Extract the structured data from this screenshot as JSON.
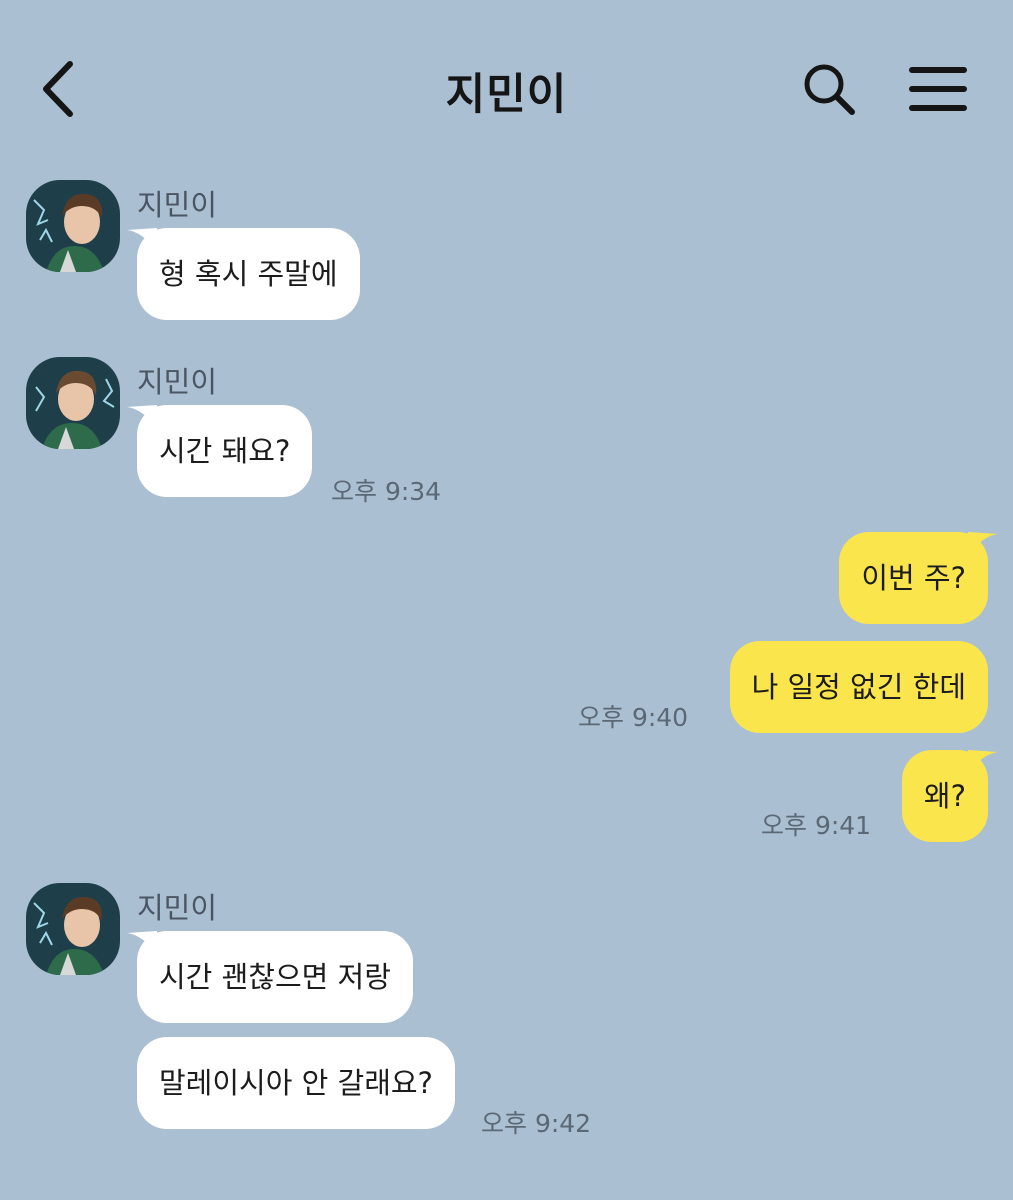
{
  "header": {
    "title": "지민이",
    "back_icon": "chevron-left-icon",
    "search_icon": "search-icon",
    "menu_icon": "hamburger-menu-icon"
  },
  "colors": {
    "background": "#abbfd2",
    "incoming_bubble": "#ffffff",
    "outgoing_bubble": "#fae54d",
    "timestamp": "#5b6875"
  },
  "messages": {
    "group1": {
      "sender": "지민이",
      "texts": [
        "형 혹시 주말에"
      ]
    },
    "group2": {
      "sender": "지민이",
      "texts": [
        "시간 돼요?"
      ],
      "time": "오후 9:34"
    },
    "group3": {
      "texts": [
        "이번 주?",
        "나 일정 없긴 한데"
      ],
      "time": "오후 9:40"
    },
    "group4": {
      "texts": [
        "왜?"
      ],
      "time": "오후 9:41"
    },
    "group5": {
      "sender": "지민이",
      "texts": [
        "시간 괜찮으면 저랑",
        "말레이시아 안 갈래요?"
      ],
      "time": "오후 9:42"
    }
  }
}
